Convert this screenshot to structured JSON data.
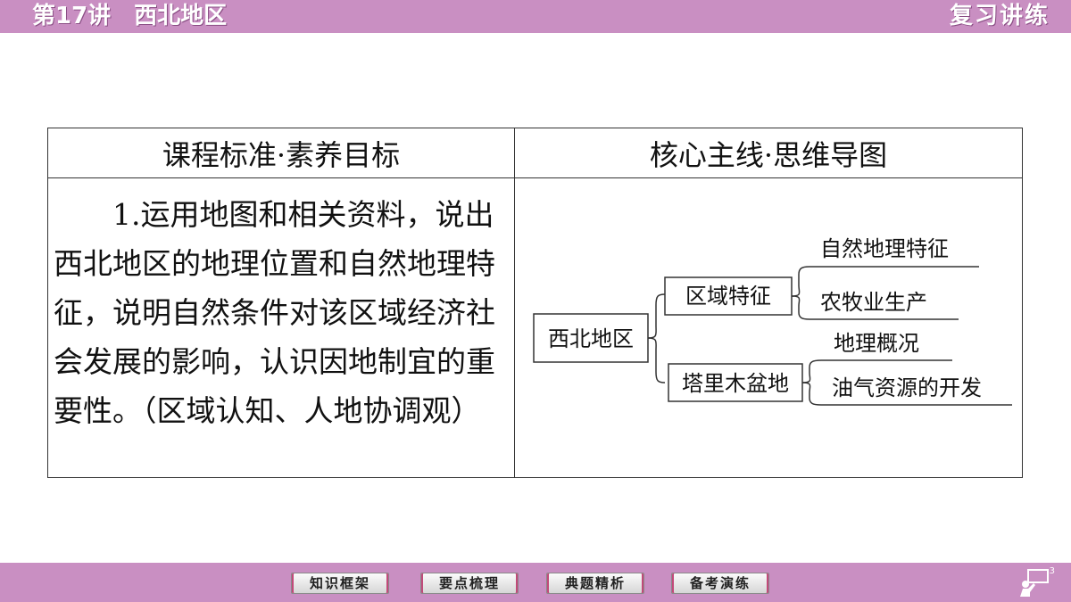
{
  "header": {
    "title": "第17讲　西北地区",
    "section": "复习讲练"
  },
  "table": {
    "headers": [
      "课程标准·素养目标",
      "核心主线·思维导图"
    ],
    "standard_text": "1.运用地图和相关资料，说出西北地区的地理位置和自然地理特征，说明自然条件对该区域经济社会发展的影响，认识因地制宜的重要性。（区域认知、人地协调观）"
  },
  "mindmap": {
    "root": "西北地区",
    "branches": [
      {
        "label": "区域特征",
        "children": [
          "自然地理特征",
          "农牧业生产"
        ]
      },
      {
        "label": "塔里木盆地",
        "children": [
          "地理概况",
          "油气资源的开发"
        ]
      }
    ]
  },
  "nav": {
    "buttons": [
      "知识框架",
      "要点梳理",
      "典题精析",
      "备考演练"
    ]
  },
  "page": {
    "number": "3"
  },
  "colors": {
    "bar": "#c98fc2",
    "button_accent": "#c24a7a"
  }
}
